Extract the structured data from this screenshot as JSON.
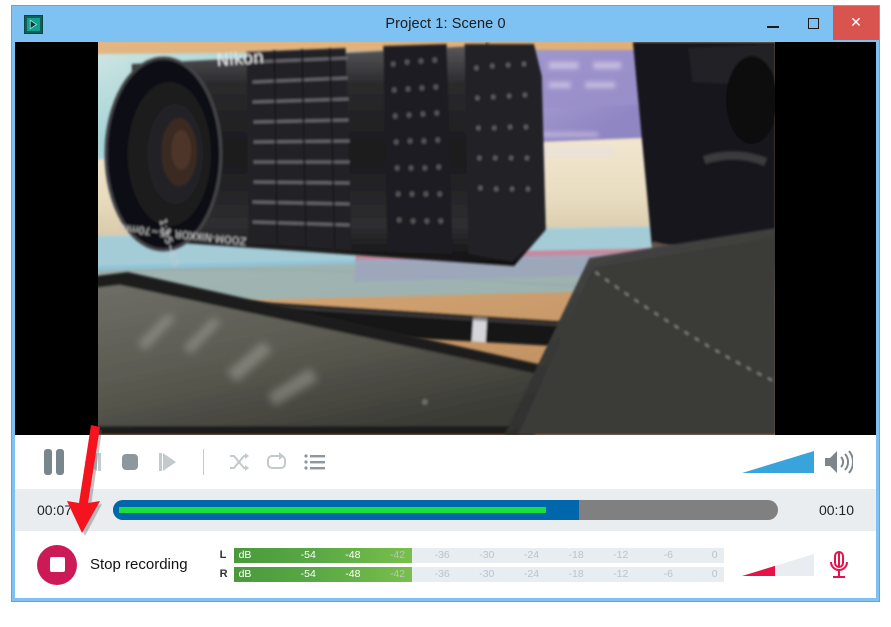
{
  "window": {
    "title": "Project 1: Scene 0",
    "app_icon": "media-player-icon",
    "controls": {
      "minimize": "minimize-icon",
      "maximize": "maximize-icon",
      "close": "✕"
    },
    "frame_color": "#7ec2f3",
    "close_color": "#d9534f"
  },
  "video": {
    "name": "video-preview",
    "description": "Nikon camera with 35-70mm Zoom-Nikkor lens, books, pen, tablet and notebook on a wooden desk",
    "background": "#000000"
  },
  "transport": {
    "pause": "pause-button",
    "previous": "previous-track-button",
    "stop": "stop-button",
    "next": "next-track-button",
    "shuffle": "shuffle-button",
    "repeat": "repeat-button",
    "playlist": "playlist-button",
    "volume_slider": "volume-slider",
    "volume_icon": "speaker-icon",
    "volume_percent": 100,
    "accent": "#39a3dc"
  },
  "progress": {
    "elapsed": "00:07",
    "duration": "00:10",
    "played_percent": 70,
    "buffer_percent": 66,
    "played_color": "#0067ac",
    "buffer_color": "#19e03c",
    "track_color": "#808080"
  },
  "recording": {
    "button_label": "Stop recording",
    "button_icon": "stop-recording-icon",
    "button_color": "#cc1a56",
    "mic_slider": "microphone-gain-slider",
    "mic_icon": "microphone-icon",
    "mic_gain_percent": 46,
    "mic_color": "#e8124a",
    "meters": {
      "scale": [
        "dB",
        "-54",
        "-48",
        "-42",
        "-36",
        "-30",
        "-24",
        "-18",
        "-12",
        "-6",
        "0"
      ],
      "lit_segments": 3,
      "channels": [
        {
          "label": "L",
          "level_percent": 27.5
        },
        {
          "label": "R",
          "level_percent": 27.5
        }
      ],
      "fill_color": "#59a845",
      "empty_color": "#e8edf1"
    }
  },
  "annotation": {
    "arrow": "red-annotation-arrow",
    "color": "#f5141e",
    "points_to": "Stop recording"
  }
}
